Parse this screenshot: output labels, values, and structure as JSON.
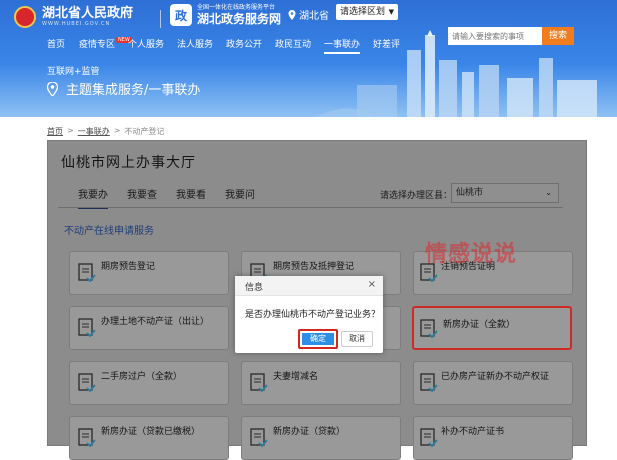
{
  "header": {
    "gov_title": "湖北省人民政府",
    "gov_subtitle": "WWW.HUBEI.GOV.CN",
    "service_tag": "全国一体化在线政务服务平台",
    "service_title": "湖北政务服务网",
    "location": "湖北省",
    "region_select": "请选择区划",
    "nav": [
      "首页",
      "疫情专区",
      "个人服务",
      "法人服务",
      "政务公开",
      "政民互动",
      "一事联办",
      "好差评"
    ],
    "nav_badge": "NEW",
    "search_placeholder": "请输入要搜索的事项",
    "search_button": "搜索",
    "supervision": "互联网+监管",
    "page_heading": "主题集成服务/一事联办"
  },
  "breadcrumb": {
    "home": "首页",
    "sep": ">",
    "level1": "一事联办",
    "level2": "不动产登记"
  },
  "panel": {
    "title": "仙桃市网上办事大厅",
    "tabs": [
      "我要办",
      "我要查",
      "我要看",
      "我要问"
    ],
    "district_label": "请选择办理区县：",
    "district_value": "仙桃市",
    "section_title": "不动产在线申请服务"
  },
  "cards": [
    "期房预告登记",
    "期房预告及抵押登记",
    "注销预告证明",
    "办理土地不动产证（出让）",
    "",
    "新房办证（全款）",
    "二手房过户（全款）",
    "夫妻增减名",
    "已办房产证新办不动产权证",
    "新房办证（贷款已缴税）",
    "新房办证（贷款）",
    "补办不动产证书"
  ],
  "watermark": "情感说说",
  "dialog": {
    "title": "信息",
    "close": "×",
    "message": "是否办理仙桃市不动产登记业务？",
    "ok": "确定",
    "cancel": "取消"
  },
  "colors": {
    "header_blue": "#3a86e8",
    "search_orange": "#f07c1d",
    "highlight_red": "#cc2a22",
    "ok_blue": "#2d8ee8"
  }
}
